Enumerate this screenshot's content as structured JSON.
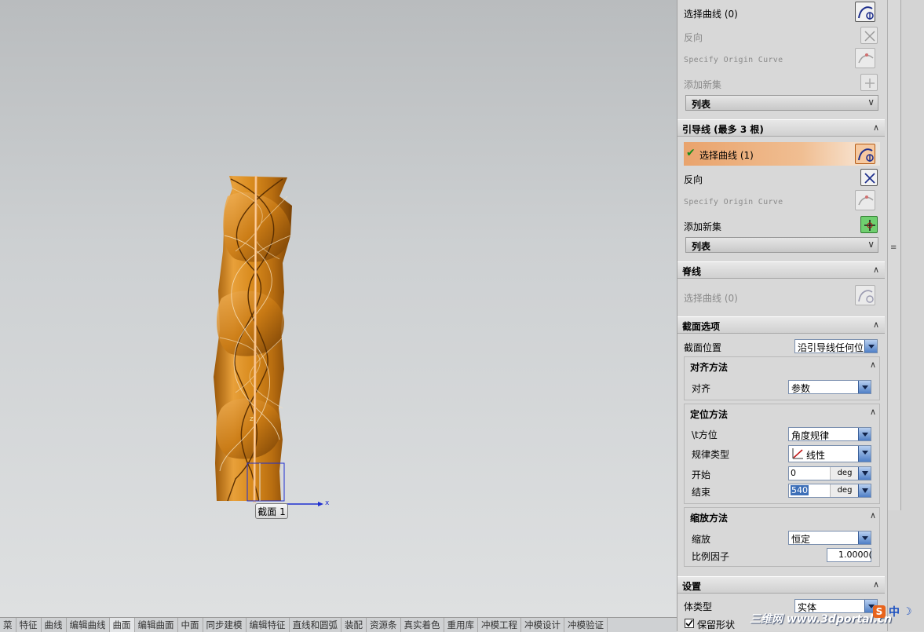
{
  "viewport": {
    "tooltip": "截面 1",
    "axis_x_label": "x",
    "axis_z_label": "z"
  },
  "tabbar": {
    "tabs": [
      "菜",
      "特征",
      "曲线",
      "编辑曲线",
      "曲面",
      "编辑曲面",
      "中面",
      "同步建模",
      "编辑特征",
      "直线和圆弧",
      "装配",
      "资源条",
      "真实着色",
      "重用库",
      "冲模工程",
      "冲模设计",
      "冲模验证"
    ],
    "active": "曲面"
  },
  "section_top": {
    "select_curve": "选择曲线 (0)",
    "reverse": "反向",
    "specify_origin": "Specify Origin Curve",
    "add_new_set": "添加新集",
    "list": "列表"
  },
  "guide": {
    "header": "引导线 (最多 3 根)",
    "select_curve": "选择曲线 (1)",
    "reverse": "反向",
    "specify_origin": "Specify Origin Curve",
    "add_new_set": "添加新集",
    "list": "列表"
  },
  "spine": {
    "header": "脊线",
    "select_curve": "选择曲线 (0)"
  },
  "section_options": {
    "header": "截面选项",
    "position_label": "截面位置",
    "position_value": "沿引导线任何位",
    "align": {
      "header": "对齐方法",
      "label": "对齐",
      "value": "参数"
    },
    "orient": {
      "header": "定位方法",
      "orientation_label": "\\t方位",
      "orientation_value": "角度规律",
      "law_type_label": "规律类型",
      "law_type_value": "线性",
      "start_label": "开始",
      "start_value": "0",
      "start_unit": "deg",
      "end_label": "结束",
      "end_value": "540",
      "end_unit": "deg"
    },
    "scale": {
      "header": "缩放方法",
      "scale_label": "缩放",
      "scale_value": "恒定",
      "factor_label": "比例因子",
      "factor_value": "1.0000("
    }
  },
  "settings": {
    "header": "设置",
    "body_type_label": "体类型",
    "body_type_value": "实体",
    "keep_shape": "保留形状"
  },
  "watermark": "三维网 www.3dportal.cn",
  "ime": {
    "logo": "S",
    "lang": "中",
    "moon": "☽"
  },
  "colors": {
    "model_orange": "#d88a1c",
    "highlight_row": "#e9a36c",
    "panel_bg": "#d8d8d8",
    "combo_button": "#4f7fc6"
  },
  "icons": [
    "curve-select-icon",
    "reverse-direction-icon",
    "origin-curve-icon",
    "add-new-set-icon",
    "linear-law-icon",
    "check-icon"
  ]
}
